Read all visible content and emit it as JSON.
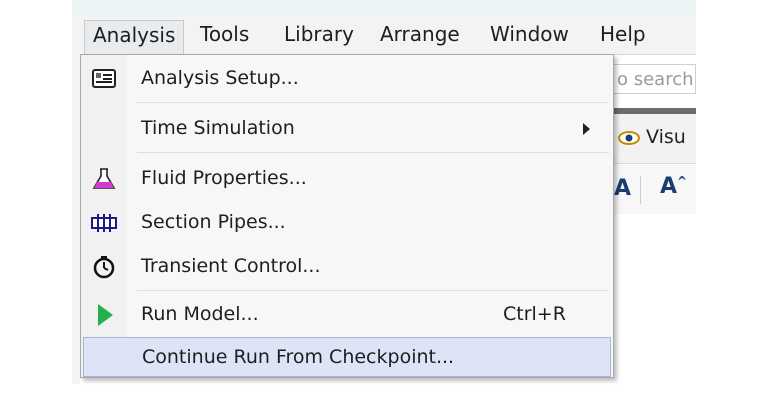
{
  "menubar": {
    "items": [
      {
        "label": "Analysis",
        "open": true
      },
      {
        "label": "Tools"
      },
      {
        "label": "Library"
      },
      {
        "label": "Arrange"
      },
      {
        "label": "Window"
      },
      {
        "label": "Help"
      }
    ]
  },
  "background": {
    "search_placeholder": "o search.",
    "visual_label": "Visu",
    "tool_a": "A",
    "tool_b": "A"
  },
  "analysis_menu": {
    "items": [
      {
        "label": "Analysis Setup...",
        "icon": "analysis-setup-icon"
      },
      {
        "label": "Time Simulation",
        "submenu": true
      },
      {
        "label": "Fluid Properties...",
        "icon": "flask-icon",
        "icon_color": "#d23bd1"
      },
      {
        "label": "Section Pipes...",
        "icon": "section-pipes-icon"
      },
      {
        "label": "Transient Control...",
        "icon": "stopwatch-icon"
      },
      {
        "label": "Run Model...",
        "icon": "run-play-icon",
        "icon_color": "#22b14c",
        "shortcut": "Ctrl+R"
      },
      {
        "label": "Continue Run From Checkpoint...",
        "highlighted": true
      }
    ]
  },
  "colors": {
    "highlight": "#dce4f5",
    "menu_bg": "#f7f7f7",
    "title_strip": "#eaf6f6"
  }
}
